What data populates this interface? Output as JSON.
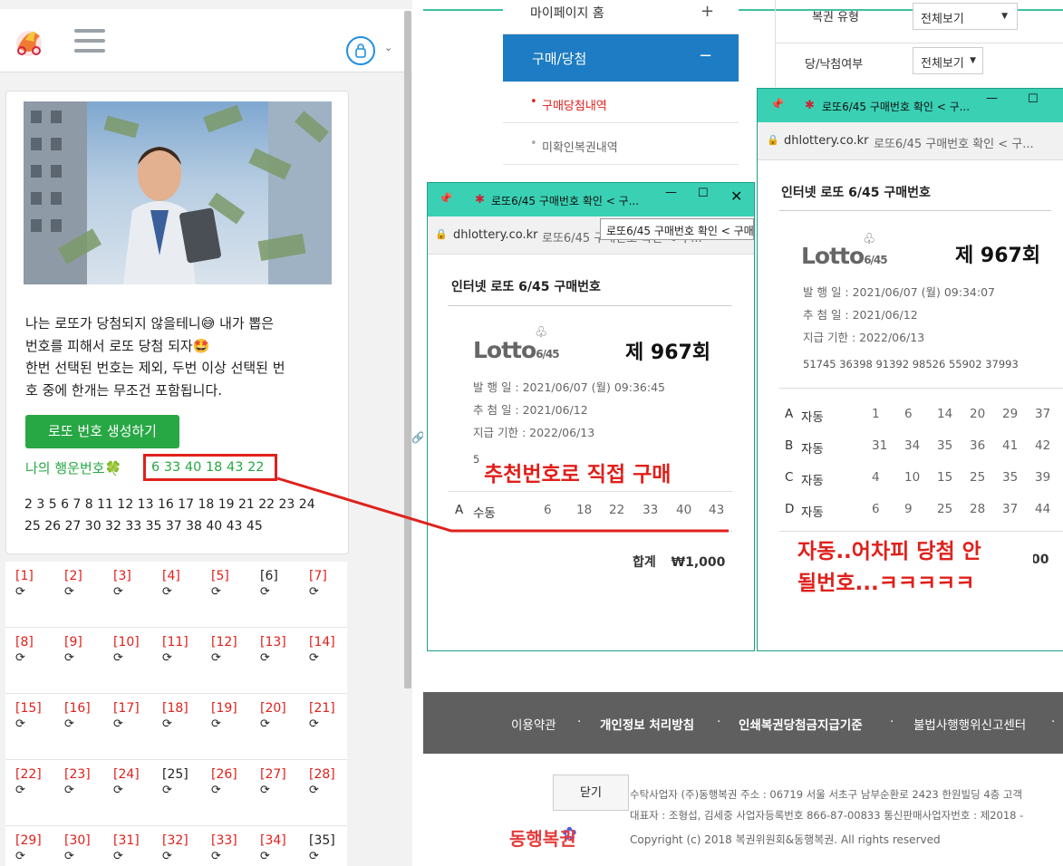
{
  "left": {
    "description_lines": [
      "나는 로또가 당첨되지 않을테니😅 내가 뽑은",
      "번호를 피해서 로또 당첨 되자🤩",
      "한번 선택된 번호는 제외, 두번 이상 선택된 번",
      "호 중에 한개는 무조건 포함됩니다."
    ],
    "generate_button": "로또 번호 생성하기",
    "lucky_label": "나의 행운번호🍀",
    "lucky_numbers": "6 33 40 18 43 22",
    "number_list_line1": "2 3 5 6 7 8 11 12 13 16 17 18 19 21 22 23 24",
    "number_list_line2": "25 26 27 30 32 33 35 37 38 40 43 45",
    "rotate_glyph": "⟳",
    "grid": [
      [
        "[1]",
        "[2]",
        "[3]",
        "[4]",
        "[5]",
        "[6]",
        "[7]"
      ],
      [
        "[8]",
        "[9]",
        "[10]",
        "[11]",
        "[12]",
        "[13]",
        "[14]"
      ],
      [
        "[15]",
        "[16]",
        "[17]",
        "[18]",
        "[19]",
        "[20]",
        "[21]"
      ],
      [
        "[22]",
        "[23]",
        "[24]",
        "[25]",
        "[26]",
        "[27]",
        "[28]"
      ],
      [
        "[29]",
        "[30]",
        "[31]",
        "[32]",
        "[33]",
        "[34]",
        "[35]"
      ]
    ],
    "grid_black": [
      "[6]",
      "[25]",
      "[35]"
    ]
  },
  "site": {
    "menu_top": "마이페이지 홈",
    "menu_top_sign": "+",
    "menu_active": "구매/당첨",
    "menu_active_sign": "−",
    "sub1": "구매당첨내역",
    "sub2": "미확인복권내역",
    "filter1_label": "복권 유형",
    "filter1_value": "전체보기",
    "filter2_label": "당/낙첨여부",
    "filter2_value": "전체보기"
  },
  "popup1": {
    "title": "로또6/45 구매번호 확인 < 구...",
    "domain": "dhlottery.co.kr",
    "url_title": "로또6/45 구매번호 확인 < 구...",
    "tooltip": "로또6/45 구매번호 확인 < 구매",
    "heading": "인터넷 로또 6/45 구매번호",
    "logo": "Lotto",
    "logo_sub": "6/45",
    "round": "제 967회",
    "issue": "발 행 일 : 2021/06/07 (월) 09:36:45",
    "draw": "추 첨 일 : 2021/06/12",
    "deadline": "지급 기한 : 2022/06/13",
    "barcode_partial": "5:",
    "overlay_text": "추천번호로 직접 구매",
    "line": {
      "label": "A",
      "type": "수동",
      "nums": [
        "6",
        "18",
        "22",
        "33",
        "40",
        "43"
      ]
    },
    "total_label": "합계",
    "total_value": "₩1,000",
    "close": "닫기"
  },
  "popup2": {
    "title": "로또6/45 구매번호 확인 < 구...",
    "domain": "dhlottery.co.kr",
    "url_title": "로또6/45 구매번호 확인 < 구...",
    "heading": "인터넷 로또 6/45 구매번호",
    "logo": "Lotto",
    "logo_sub": "6/45",
    "round": "제 967회",
    "issue": "발 행 일 : 2021/06/07 (월) 09:34:07",
    "draw": "추 첨 일 : 2021/06/12",
    "deadline": "지급 기한 : 2022/06/13",
    "barcode": "51745 36398 91392 98526 55902 37993",
    "lines": [
      {
        "label": "A",
        "type": "자동",
        "nums": [
          "1",
          "6",
          "14",
          "20",
          "29",
          "37"
        ]
      },
      {
        "label": "B",
        "type": "자동",
        "nums": [
          "31",
          "34",
          "35",
          "36",
          "41",
          "42"
        ]
      },
      {
        "label": "C",
        "type": "자동",
        "nums": [
          "4",
          "10",
          "15",
          "25",
          "35",
          "39"
        ]
      },
      {
        "label": "D",
        "type": "자동",
        "nums": [
          "6",
          "9",
          "25",
          "28",
          "37",
          "44"
        ]
      }
    ],
    "total_partial": "00",
    "overlay_line1": "자동..어차피 당첨 안",
    "overlay_line2": "될번호...ㅋㅋㅋㅋㅋ"
  },
  "footer": {
    "links": [
      "이용약관",
      "개인정보 처리방침",
      "인쇄복권당첨금지급기준",
      "불법사행행위신고센터"
    ],
    "sep": "·",
    "info1": "수탁사업자 (주)동행복권     주소 : 06719 서울 서초구 남부순환로 2423 한원빌딩 4층     고객",
    "info2": "대표자 : 조형섭, 김세중     사업자등록번호 866-87-00833     통신판매사업자번호 : 제2018 -",
    "copyright": "Copyright (c) 2018 복권위원회&동행복권. All rights reserved",
    "logo_text": "동행복권"
  },
  "colors": {
    "accent_red": "#e0201b",
    "green": "#28a745",
    "blue": "#1d7cc3",
    "teal": "#3ad0b4"
  }
}
